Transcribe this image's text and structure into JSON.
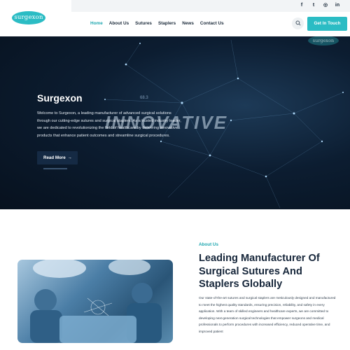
{
  "logo": {
    "text": "surgexon"
  },
  "social": [
    {
      "icon": "facebook-icon",
      "glyph": "f"
    },
    {
      "icon": "twitter-icon",
      "glyph": "t"
    },
    {
      "icon": "instagram-icon",
      "glyph": "◎"
    },
    {
      "icon": "linkedin-icon",
      "glyph": "in"
    }
  ],
  "nav": {
    "items": [
      {
        "label": "Home",
        "active": true
      },
      {
        "label": "About Us"
      },
      {
        "label": "Sutures"
      },
      {
        "label": "Staplers"
      },
      {
        "label": "News"
      },
      {
        "label": "Contact Us"
      }
    ],
    "search_icon": "search-icon",
    "cta_label": "Get In Touch"
  },
  "hero": {
    "title": "Surgexon",
    "text": "Welcome to Surgexon, a leading manufacturer of advanced surgical solutions through our cutting-edge sutures and surgical staplers. As a trusted industry leader, we are dedicated to revolutionizing the field of healthcare by delivering innovative products that enhance patient outcomes and streamline surgical procedures.",
    "button_label": "Read More",
    "button_icon": "arrow-right-icon",
    "background_word": "INNOVATIVE",
    "background_number": "68.3",
    "background_logo": "surgexon"
  },
  "about": {
    "label": "About Us",
    "title": "Leading Manufacturer Of Surgical Sutures And Staplers Globally",
    "text": "Our state-of-the-art sutures and surgical staplers are meticulously designed and manufactured to meet the highest quality standards, ensuring precision, reliability, and safety in every application. With a team of skilled engineers and healthcare experts, we are committed to developing next-generation surgical technologies that empower surgeons and medical professionals to perform procedures with increased efficiency, reduced operative time, and improved patient"
  },
  "colors": {
    "accent": "#2bbcc4",
    "nav_active": "#1fa7b0",
    "hero_bg": "#0c1d31",
    "dark_text": "#16263a"
  }
}
